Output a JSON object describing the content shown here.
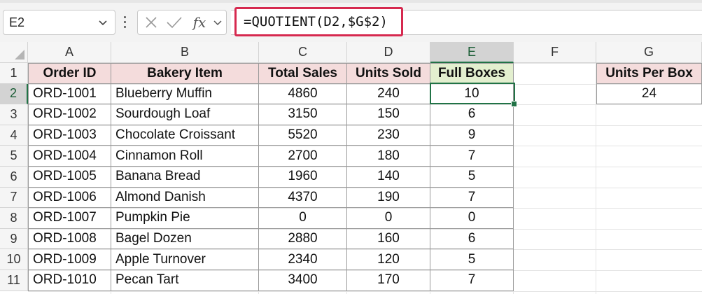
{
  "formula_bar": {
    "name_box": "E2",
    "formula": "=QUOTIENT(D2,$G$2)",
    "fx_label": "fx",
    "icons": [
      "chevron-down-icon",
      "more-dots-icon",
      "cancel-x-icon",
      "confirm-check-icon",
      "function-fx-icon",
      "chevron-down-icon"
    ]
  },
  "columns": [
    "A",
    "B",
    "C",
    "D",
    "E",
    "F",
    "G"
  ],
  "rows": [
    "1",
    "2",
    "3",
    "4",
    "5",
    "6",
    "7",
    "8",
    "9",
    "10",
    "11"
  ],
  "selected_cell": "E2",
  "colors": {
    "header_fill": "#f4dcdc",
    "highlight_fill": "#e3efcf",
    "selection": "#217346",
    "formula_outline": "#d6294f"
  },
  "table": {
    "headers": [
      "Order ID",
      "Bakery Item",
      "Total Sales",
      "Units Sold",
      "Full Boxes"
    ],
    "rows": [
      [
        "ORD-1001",
        "Blueberry Muffin",
        "4860",
        "240",
        "10"
      ],
      [
        "ORD-1002",
        "Sourdough Loaf",
        "3150",
        "150",
        "6"
      ],
      [
        "ORD-1003",
        "Chocolate Croissant",
        "5520",
        "230",
        "9"
      ],
      [
        "ORD-1004",
        "Cinnamon Roll",
        "2700",
        "180",
        "7"
      ],
      [
        "ORD-1005",
        "Banana Bread",
        "1960",
        "140",
        "5"
      ],
      [
        "ORD-1006",
        "Almond Danish",
        "4370",
        "190",
        "7"
      ],
      [
        "ORD-1007",
        "Pumpkin Pie",
        "0",
        "0",
        "0"
      ],
      [
        "ORD-1008",
        "Bagel Dozen",
        "2880",
        "160",
        "6"
      ],
      [
        "ORD-1009",
        "Apple Turnover",
        "2340",
        "120",
        "5"
      ],
      [
        "ORD-1010",
        "Pecan Tart",
        "3400",
        "170",
        "7"
      ]
    ]
  },
  "units_per_box": {
    "header": "Units Per Box",
    "value": "24"
  }
}
